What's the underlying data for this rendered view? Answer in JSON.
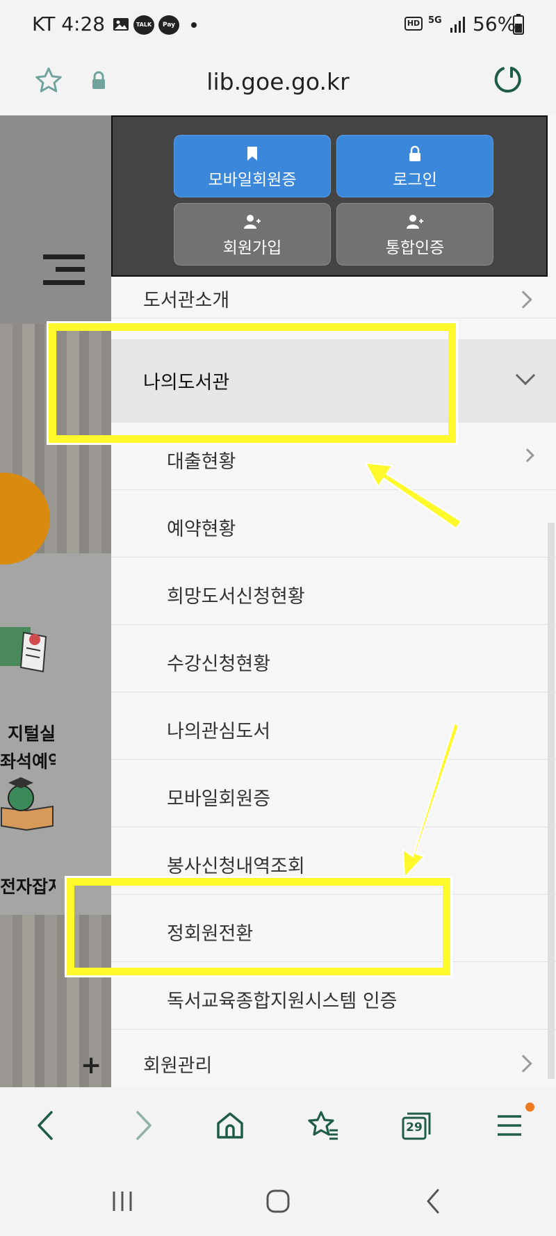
{
  "status_bar": {
    "time": "KT 4:28",
    "battery": "56%",
    "notif_icons": [
      "gallery-icon",
      "kakaotalk-icon",
      "kakaopay-icon",
      "dot-icon"
    ],
    "right_icons": [
      "hd-icon",
      "5g-icon",
      "signal-icon",
      "battery-icon"
    ],
    "talk_label": "TALK",
    "pay_label": "Pay",
    "hd_label": "HD",
    "net_label": "5G"
  },
  "address_bar": {
    "url": "lib.goe.go.kr",
    "left_icons": [
      "star-icon",
      "lock-icon"
    ],
    "right_icon": "refresh-icon"
  },
  "background_site": {
    "label_1": "지털실",
    "label_2": "좌석예약",
    "label_3": "전자잡지",
    "plus": "+"
  },
  "auth_buttons": [
    {
      "label": "모바일회원증",
      "icon": "bookmark-icon"
    },
    {
      "label": "로그인",
      "icon": "lock-icon"
    },
    {
      "label": "회원가입",
      "icon": "user-add-icon"
    },
    {
      "label": "통합인증",
      "icon": "user-add-icon"
    }
  ],
  "menu": {
    "top": {
      "label": "도서관소개"
    },
    "active": {
      "label": "나의도서관"
    },
    "sub_items": [
      {
        "label": "대출현황",
        "has_chevron": true
      },
      {
        "label": "예약현황"
      },
      {
        "label": "희망도서신청현황"
      },
      {
        "label": "수강신청현황"
      },
      {
        "label": "나의관심도서"
      },
      {
        "label": "모바일회원증"
      },
      {
        "label": "봉사신청내역조회"
      },
      {
        "label": "정회원전환"
      },
      {
        "label": "독서교육종합지원시스템 인증"
      }
    ],
    "bottom": {
      "label": "회원관리"
    }
  },
  "bottom_toolbar": {
    "tab_count": "29",
    "icons": [
      "back-icon",
      "forward-icon",
      "home-icon",
      "bookmarks-icon",
      "tabs-icon",
      "menu-icon"
    ]
  },
  "colors": {
    "accent_blue": "#3b87d9",
    "highlight_yellow": "#fff82a",
    "brand_green": "#1e5c48",
    "orange": "#d98b10"
  }
}
